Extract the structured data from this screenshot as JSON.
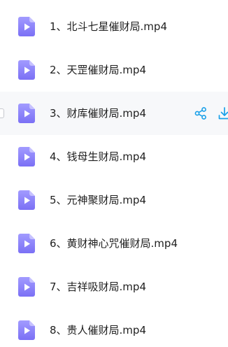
{
  "files": [
    {
      "name": "1、北斗七星催财局.mp4",
      "icon": "video-file-icon"
    },
    {
      "name": "2、天罡催财局.mp4",
      "icon": "video-file-icon"
    },
    {
      "name": "3、财库催财局.mp4",
      "icon": "video-file-icon",
      "hovered": true
    },
    {
      "name": "4、钱母生财局.mp4",
      "icon": "video-file-icon"
    },
    {
      "name": "5、元神聚财局.mp4",
      "icon": "video-file-icon"
    },
    {
      "name": "6、黄财神心咒催财局.mp4",
      "icon": "video-file-icon"
    },
    {
      "name": "7、吉祥吸财局.mp4",
      "icon": "video-file-icon"
    },
    {
      "name": "8、贵人催财局.mp4",
      "icon": "video-file-icon"
    }
  ],
  "row_actions": {
    "share_icon": "share-icon",
    "download_icon": "download-icon"
  },
  "colors": {
    "icon_top": "#a29bff",
    "icon_bottom": "#7b70f5",
    "action": "#1aa0e8",
    "hover_bg": "#f7f8fa"
  }
}
